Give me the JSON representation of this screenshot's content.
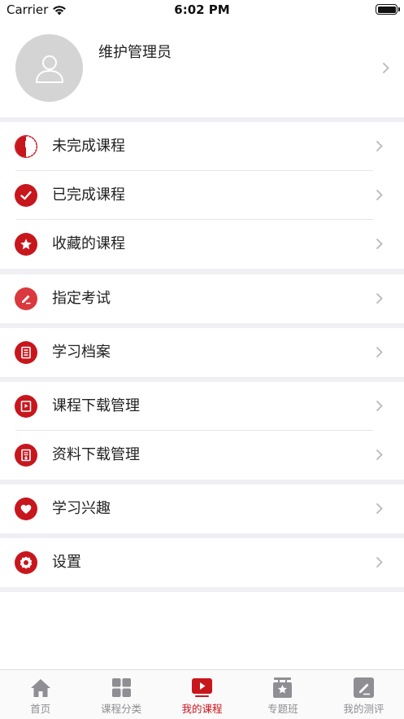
{
  "status_bar": {
    "carrier": "Carrier",
    "time": "6:02 PM"
  },
  "profile": {
    "name": "维护管理员"
  },
  "menu": {
    "unfinished": "未完成课程",
    "finished": "已完成课程",
    "favorites": "收藏的课程",
    "exam": "指定考试",
    "records": "学习档案",
    "course_download": "课程下载管理",
    "material_download": "资料下载管理",
    "interest": "学习兴趣",
    "settings": "设置"
  },
  "tabs": [
    {
      "label": "首页",
      "icon": "home-icon"
    },
    {
      "label": "课程分类",
      "icon": "grid-icon"
    },
    {
      "label": "我的课程",
      "icon": "play-icon"
    },
    {
      "label": "专题班",
      "icon": "badge-icon"
    },
    {
      "label": "我的测评",
      "icon": "edit-icon"
    }
  ],
  "active_tab": "我的课程",
  "colors": {
    "accent": "#c8161d",
    "background": "#efeff4",
    "inactive": "#8e8e93"
  }
}
